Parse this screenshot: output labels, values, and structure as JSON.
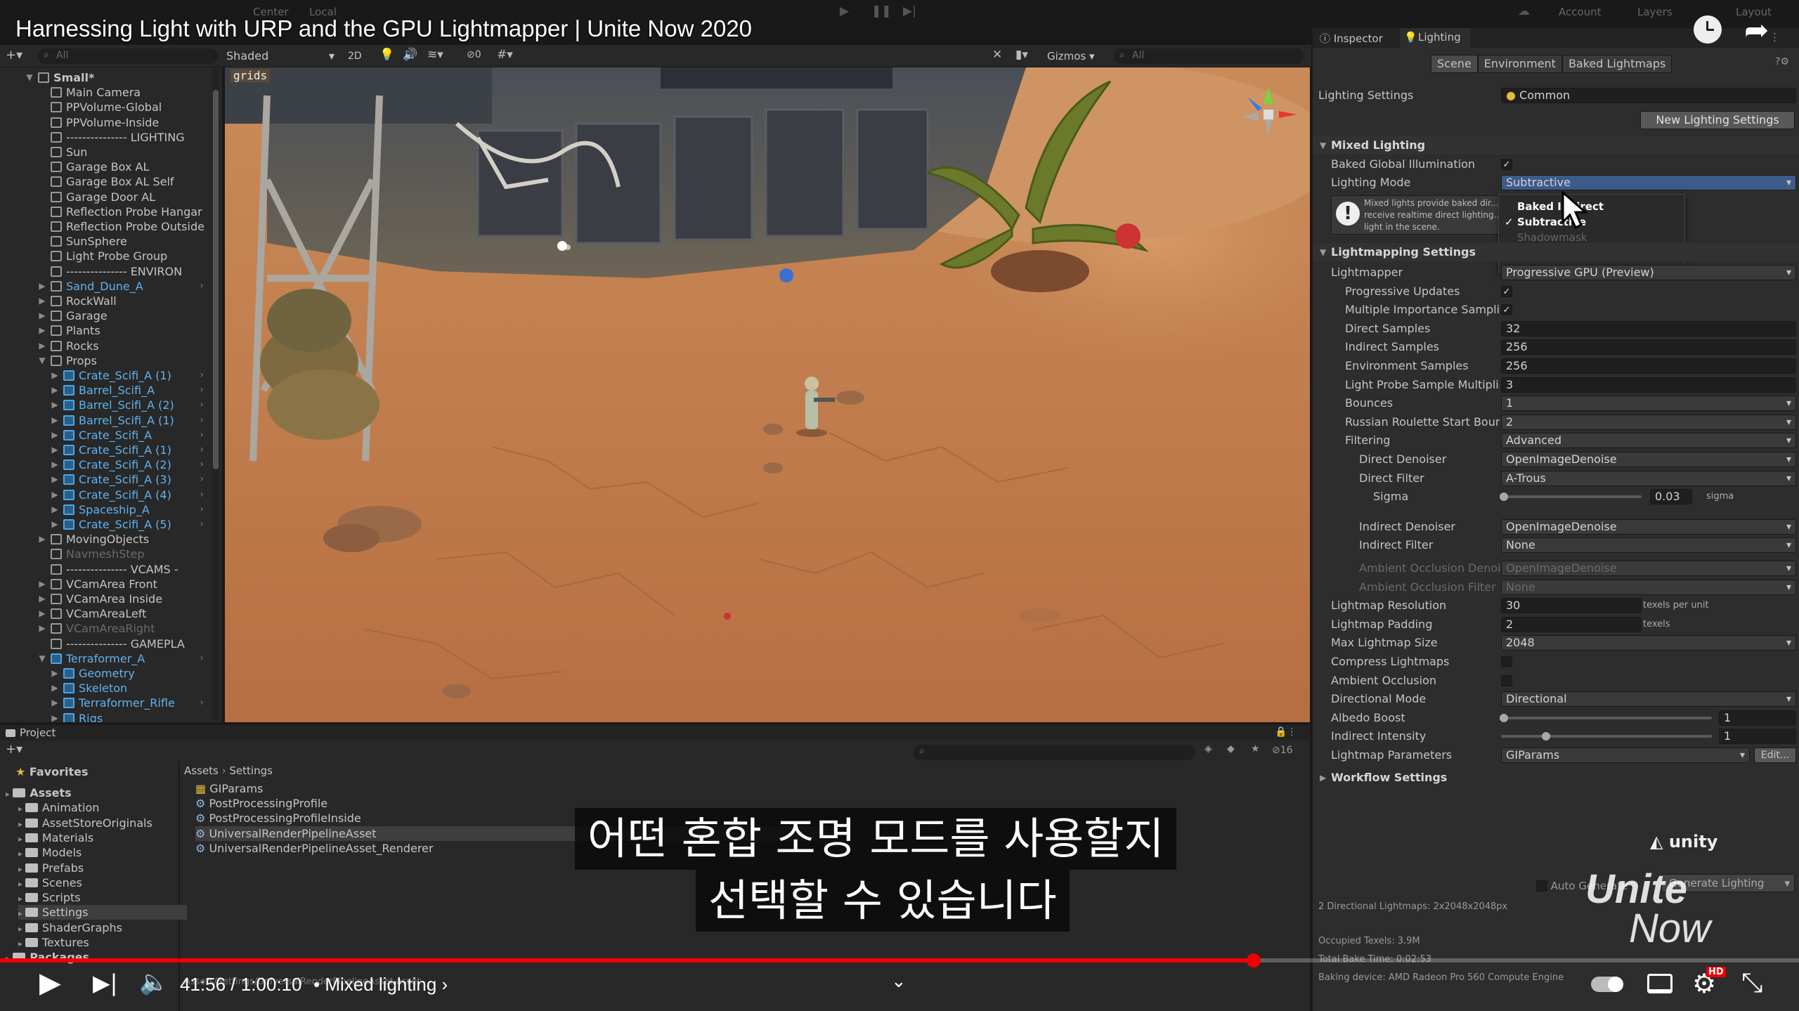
{
  "video": {
    "title": "Harnessing Light with URP and the GPU Lightmapper | Unite Now 2020",
    "subtitle_line1": "어떤 혼합 조명 모드를 사용할지",
    "subtitle_line2": "선택할 수 있습니다",
    "time": "41:56 / 1:00:10",
    "chapter": "• Mixed lighting ›",
    "progress": 0.697,
    "hd_badge": "HD"
  },
  "toolbar": {
    "center": "Center",
    "local": "Local",
    "account": "Account",
    "layers": "Layers",
    "layout": "Layout",
    "shading": "Shaded",
    "mode2d": "2D",
    "gizmos": "Gizmos",
    "search_all": "All",
    "hidden_count": "0",
    "grids": "grids"
  },
  "hierarchy": {
    "search_placeholder": "All",
    "items": [
      {
        "label": "Small*",
        "depth": 0,
        "expand": "▼",
        "icon": "unity",
        "style": "bold"
      },
      {
        "label": "Main Camera",
        "depth": 1,
        "icon": "cube"
      },
      {
        "label": "PPVolume-Global",
        "depth": 1,
        "icon": "cube"
      },
      {
        "label": "PPVolume-Inside",
        "depth": 1,
        "icon": "cube"
      },
      {
        "label": "--------------- LIGHTING",
        "depth": 1,
        "icon": "cube"
      },
      {
        "label": "Sun",
        "depth": 1,
        "icon": "cube"
      },
      {
        "label": "Garage Box AL",
        "depth": 1,
        "icon": "cube"
      },
      {
        "label": "Garage Box AL Self",
        "depth": 1,
        "icon": "cube"
      },
      {
        "label": "Garage Door AL",
        "depth": 1,
        "icon": "cube"
      },
      {
        "label": "Reflection Probe Hangar",
        "depth": 1,
        "icon": "cube"
      },
      {
        "label": "Reflection Probe Outside",
        "depth": 1,
        "icon": "cube"
      },
      {
        "label": "SunSphere",
        "depth": 1,
        "icon": "cube"
      },
      {
        "label": "Light Probe Group",
        "depth": 1,
        "icon": "cube"
      },
      {
        "label": "--------------- ENVIRON",
        "depth": 1,
        "icon": "cube"
      },
      {
        "label": "Sand_Dune_A",
        "depth": 1,
        "expand": "▶",
        "icon": "cube",
        "style": "blue",
        "chev": true
      },
      {
        "label": "RockWall",
        "depth": 1,
        "expand": "▶",
        "icon": "cube"
      },
      {
        "label": "Garage",
        "depth": 1,
        "expand": "▶",
        "icon": "cube"
      },
      {
        "label": "Plants",
        "depth": 1,
        "expand": "▶",
        "icon": "cube"
      },
      {
        "label": "Rocks",
        "depth": 1,
        "expand": "▶",
        "icon": "cube"
      },
      {
        "label": "Props",
        "depth": 1,
        "expand": "▼",
        "icon": "cube"
      },
      {
        "label": "Crate_Scifi_A (1)",
        "depth": 2,
        "expand": "▶",
        "icon": "prefab",
        "style": "blue",
        "chev": true
      },
      {
        "label": "Barrel_Scifi_A",
        "depth": 2,
        "expand": "▶",
        "icon": "prefab",
        "style": "blue",
        "chev": true
      },
      {
        "label": "Barrel_Scifi_A (2)",
        "depth": 2,
        "expand": "▶",
        "icon": "prefab",
        "style": "blue",
        "chev": true
      },
      {
        "label": "Barrel_Scifi_A (1)",
        "depth": 2,
        "expand": "▶",
        "icon": "prefab",
        "style": "blue",
        "chev": true
      },
      {
        "label": "Crate_Scifi_A",
        "depth": 2,
        "expand": "▶",
        "icon": "prefab",
        "style": "blue",
        "chev": true
      },
      {
        "label": "Crate_Scifi_A (1)",
        "depth": 2,
        "expand": "▶",
        "icon": "prefab",
        "style": "blue",
        "chev": true
      },
      {
        "label": "Crate_Scifi_A (2)",
        "depth": 2,
        "expand": "▶",
        "icon": "prefab",
        "style": "blue",
        "chev": true
      },
      {
        "label": "Crate_Scifi_A (3)",
        "depth": 2,
        "expand": "▶",
        "icon": "prefab",
        "style": "blue",
        "chev": true
      },
      {
        "label": "Crate_Scifi_A (4)",
        "depth": 2,
        "expand": "▶",
        "icon": "prefab",
        "style": "blue",
        "chev": true
      },
      {
        "label": "Spaceship_A",
        "depth": 2,
        "expand": "▶",
        "icon": "prefab",
        "style": "blue",
        "chev": true
      },
      {
        "label": "Crate_Scifi_A (5)",
        "depth": 2,
        "expand": "▶",
        "icon": "prefab",
        "style": "blue",
        "chev": true
      },
      {
        "label": "MovingObjects",
        "depth": 1,
        "expand": "▶",
        "icon": "cube"
      },
      {
        "label": "NavmeshStep",
        "depth": 1,
        "icon": "cube",
        "style": "dim"
      },
      {
        "label": "--------------- VCAMS -",
        "depth": 1,
        "icon": "cube"
      },
      {
        "label": "VCamArea Front",
        "depth": 1,
        "expand": "▶",
        "icon": "cube"
      },
      {
        "label": "VCamArea Inside",
        "depth": 1,
        "expand": "▶",
        "icon": "cube"
      },
      {
        "label": "VCamAreaLeft",
        "depth": 1,
        "expand": "▶",
        "icon": "cube"
      },
      {
        "label": "VCamAreaRight",
        "depth": 1,
        "expand": "▶",
        "icon": "cube",
        "style": "dim"
      },
      {
        "label": "--------------- GAMEPLA",
        "depth": 1,
        "icon": "cube"
      },
      {
        "label": "Terraformer_A",
        "depth": 1,
        "expand": "▼",
        "icon": "prefab",
        "style": "blue",
        "chev": true
      },
      {
        "label": "Geometry",
        "depth": 2,
        "expand": "▶",
        "icon": "prefab",
        "style": "blue"
      },
      {
        "label": "Skeleton",
        "depth": 2,
        "expand": "▶",
        "icon": "prefab",
        "style": "blue"
      },
      {
        "label": "Terraformer_Rifle",
        "depth": 2,
        "expand": "▶",
        "icon": "prefab",
        "style": "blue",
        "chev": true
      },
      {
        "label": "Rigs",
        "depth": 2,
        "expand": "▶",
        "icon": "prefab",
        "style": "blue"
      }
    ]
  },
  "inspector": {
    "tab_inspector": "Inspector",
    "tab_lighting": "Lighting",
    "subtab_scene": "Scene",
    "subtab_environment": "Environment",
    "subtab_baked": "Baked Lightmaps",
    "lighting_settings_label": "Lighting Settings",
    "lighting_settings_value": "Common",
    "new_settings_button": "New Lighting Settings",
    "mixed_lighting_header": "Mixed Lighting",
    "baked_gi_label": "Baked Global Illumination",
    "lighting_mode_label": "Lighting Mode",
    "lighting_mode_value": "Subtractive",
    "help_text": "Mixed lights provide baked dir... receive realtime direct lighting... light in the scene.",
    "dropdown_options": [
      "Baked Indirect",
      "Subtractive",
      "Shadowmask"
    ],
    "lightmapping_header": "Lightmapping Settings",
    "rows": [
      {
        "label": "Lightmapper",
        "value": "Progressive GPU (Preview)",
        "kind": "dd",
        "indent": 0
      },
      {
        "label": "Progressive Updates",
        "value": "✓",
        "kind": "cb",
        "indent": 1
      },
      {
        "label": "Multiple Importance Sampling",
        "value": "✓",
        "kind": "cb",
        "indent": 1
      },
      {
        "label": "Direct Samples",
        "value": "32",
        "kind": "field",
        "indent": 1
      },
      {
        "label": "Indirect Samples",
        "value": "256",
        "kind": "field",
        "indent": 1
      },
      {
        "label": "Environment Samples",
        "value": "256",
        "kind": "field",
        "indent": 1
      },
      {
        "label": "Light Probe Sample Multiplier",
        "value": "3",
        "kind": "field",
        "indent": 1
      },
      {
        "label": "Bounces",
        "value": "1",
        "kind": "dd",
        "indent": 1
      },
      {
        "label": "Russian Roulette Start Bounce",
        "value": "2",
        "kind": "dd",
        "indent": 1
      },
      {
        "label": "Filtering",
        "value": "Advanced",
        "kind": "dd",
        "indent": 1
      },
      {
        "label": "Direct Denoiser",
        "value": "OpenImageDenoise",
        "kind": "dd",
        "indent": 2
      },
      {
        "label": "Direct Filter",
        "value": "A-Trous",
        "kind": "dd",
        "indent": 2
      },
      {
        "label": "Sigma",
        "value": "0.03",
        "kind": "sigma",
        "indent": 3,
        "unit": "sigma",
        "level": 0.0
      },
      {
        "label": "",
        "value": "",
        "kind": "gap",
        "indent": 0
      },
      {
        "label": "Indirect Denoiser",
        "value": "OpenImageDenoise",
        "kind": "dd",
        "indent": 2
      },
      {
        "label": "Indirect Filter",
        "value": "None",
        "kind": "dd",
        "indent": 2
      },
      {
        "label": "",
        "value": "",
        "kind": "gap",
        "indent": 0
      },
      {
        "label": "Ambient Occlusion Denoiser",
        "value": "OpenImageDenoise",
        "kind": "dd",
        "indent": 2,
        "dim": true
      },
      {
        "label": "Ambient Occlusion Filter",
        "value": "None",
        "kind": "dd",
        "indent": 2,
        "dim": true
      },
      {
        "label": "Lightmap Resolution",
        "value": "30",
        "kind": "unitfield",
        "indent": 0,
        "unit": "texels per unit"
      },
      {
        "label": "Lightmap Padding",
        "value": "2",
        "kind": "unitfield",
        "indent": 0,
        "unit": "texels"
      },
      {
        "label": "Max Lightmap Size",
        "value": "2048",
        "kind": "dd",
        "indent": 0
      },
      {
        "label": "Compress Lightmaps",
        "value": "",
        "kind": "cb",
        "indent": 0
      },
      {
        "label": "Ambient Occlusion",
        "value": "",
        "kind": "cb",
        "indent": 0
      },
      {
        "label": "Directional Mode",
        "value": "Directional",
        "kind": "dd",
        "indent": 0
      },
      {
        "label": "Albedo Boost",
        "value": "1",
        "kind": "slider",
        "indent": 0,
        "level": 0.0
      },
      {
        "label": "Indirect Intensity",
        "value": "1",
        "kind": "slider",
        "indent": 0,
        "level": 0.2
      },
      {
        "label": "Lightmap Parameters",
        "value": "GIParams",
        "kind": "params",
        "indent": 0,
        "button": "Edit..."
      }
    ],
    "workflow_header": "Workflow Settings",
    "auto_generate": "Auto Generate",
    "generate_lighting": "Generate Lighting",
    "stats_line1": "2 Directional Lightmaps: 2x2048x2048px",
    "stats_line2": "Occupied Texels: 3.9M",
    "stats_line3": "Total Bake Time: 0:02:53",
    "baking_device": "Baking device: AMD Radeon Pro 560 Compute Engine",
    "unity_logo": "unity",
    "unite_logo_1": "Unite",
    "unite_logo_2": "Now"
  },
  "project": {
    "tab": "Project",
    "favorites": "Favorites",
    "breadcrumb_root": "Assets",
    "breadcrumb_leaf": "Settings",
    "hidden_count": "16",
    "path": "Assets/Settings/UniversalRenderPipelineAsset.asset",
    "tree": [
      {
        "label": "Assets",
        "depth": 0
      },
      {
        "label": "Animation",
        "depth": 1
      },
      {
        "label": "AssetStoreOriginals",
        "depth": 1
      },
      {
        "label": "Materials",
        "depth": 1
      },
      {
        "label": "Models",
        "depth": 1
      },
      {
        "label": "Prefabs",
        "depth": 1
      },
      {
        "label": "Scenes",
        "depth": 1
      },
      {
        "label": "Scripts",
        "depth": 1
      },
      {
        "label": "Settings",
        "depth": 1
      },
      {
        "label": "ShaderGraphs",
        "depth": 1
      },
      {
        "label": "Textures",
        "depth": 1
      },
      {
        "label": "Packages",
        "depth": 0
      }
    ],
    "files": [
      "GIParams",
      "PostProcessingProfile",
      "PostProcessingProfileInside",
      "UniversalRenderPipelineAsset",
      "UniversalRenderPipelineAsset_Renderer"
    ]
  }
}
